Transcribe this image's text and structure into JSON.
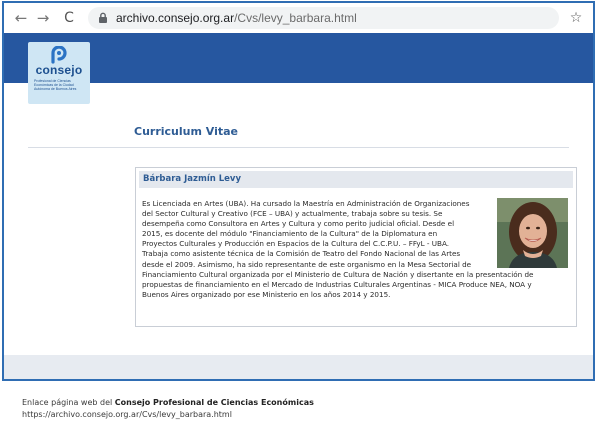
{
  "browser": {
    "url_host": "archivo.consejo.org.ar",
    "url_path": "/Cvs/levy_barbara.html",
    "back_icon": "←",
    "forward_icon": "→",
    "reload_icon": "C",
    "star_icon": "☆"
  },
  "logo": {
    "word": "consejo",
    "subtitle": "Profesional de Ciencias Económicas de la Ciudad Autónoma de Buenos Aires"
  },
  "page": {
    "title": "Curriculum Vitae"
  },
  "card": {
    "name": "Bárbara Jazmín Levy",
    "bio_lines": [
      "Es Licenciada en Artes (UBA). Ha cursado la Maestría en Administración de Organizaciones",
      "del Sector Cultural y Creativo (FCE – UBA) y actualmente, trabaja sobre su tesis. Se",
      "desempeña como Consultora en Artes y Cultura y como perito judicial oficial. Desde el",
      "2015, es docente del módulo \"Financiamiento de la Cultura\" de la Diplomatura en",
      "Proyectos Culturales y Producción en Espacios de la Cultura del C.C.P.U. – FFyL - UBA.",
      "Trabaja como asistente técnica de la Comisión de Teatro del Fondo Nacional de las Artes",
      "desde el 2009. Asimismo, ha sido representante de este organismo en la Mesa Sectorial de",
      "Financiamiento Cultural organizada por el Ministerio de Cultura de Nación y disertante en la presentación de",
      "propuestas de financiamiento en el Mercado de Industrias Culturales Argentinas - MICA Produce NEA, NOA y",
      "Buenos Aires organizado por ese Ministerio en los años 2014 y 2015."
    ]
  },
  "caption": {
    "prefix": "Enlace página web del ",
    "org": "Consejo Profesional de Ciencias Económicas",
    "url": "https://archivo.consejo.org.ar/Cvs/levy_barbara.html"
  },
  "colors": {
    "header_blue": "#2657a0",
    "title_blue": "#2e5c94",
    "frame_blue": "#2f6db3"
  }
}
